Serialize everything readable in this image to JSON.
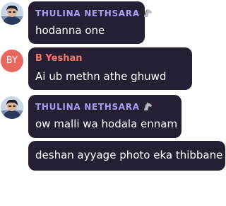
{
  "messages": [
    {
      "sender": "THULINA NETHSARA",
      "sender_icon": "horse-icon",
      "text": "hodanna one",
      "avatar": "profile-photo"
    },
    {
      "sender": "B Yeshan",
      "text": "Ai ub methn athe ghuwd",
      "avatar_initials": "BY"
    },
    {
      "sender": "THULINA NETHSARA",
      "sender_icon": "horse-icon",
      "text": "ow malli wa hodala ennam",
      "avatar": "profile-photo"
    },
    {
      "text": "deshan ayyage photo eka thibbane"
    }
  ],
  "colors": {
    "bubble": "#261f33",
    "text": "#ffffff",
    "sender_purple": "#a89cf5",
    "sender_orange": "#f4766b",
    "avatar_initials_bg": "#e8675e"
  }
}
